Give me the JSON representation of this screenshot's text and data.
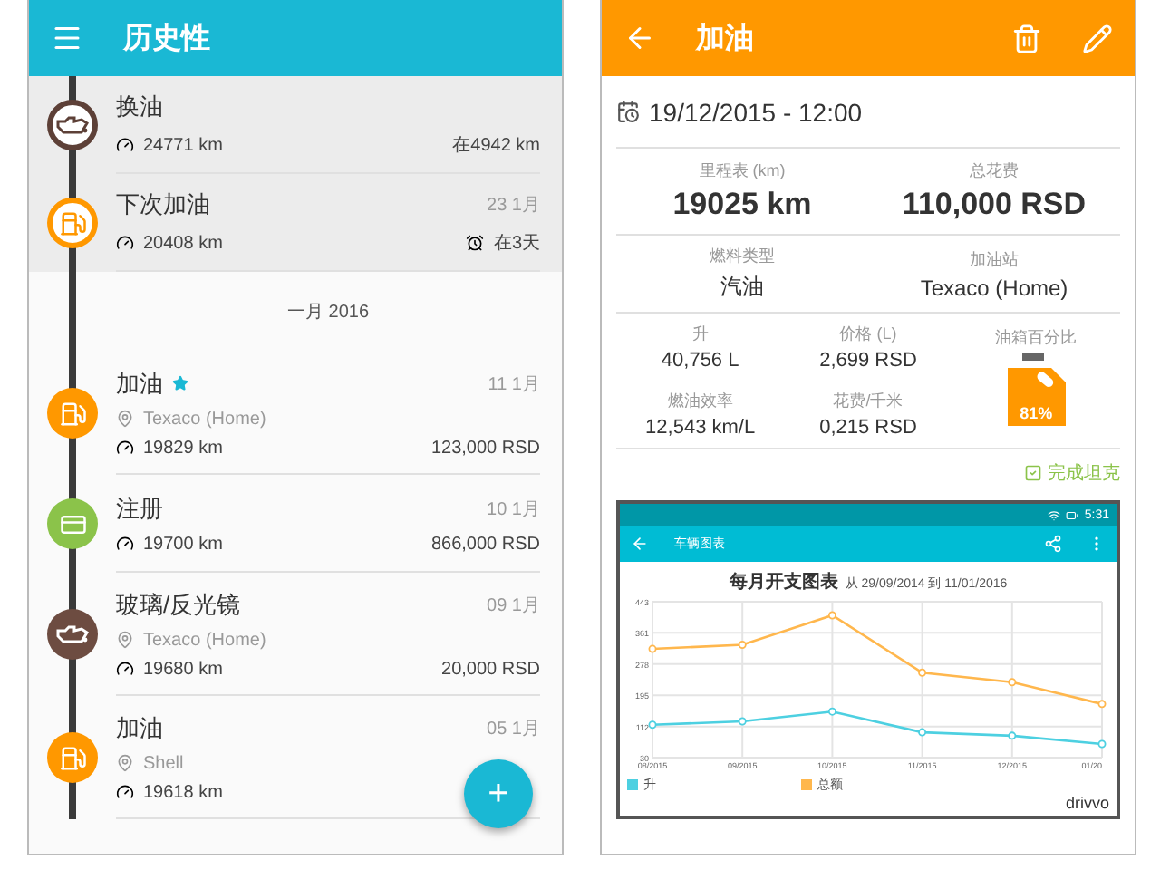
{
  "history": {
    "title": "历史性",
    "items": [
      {
        "kind": "oil",
        "color": "#5d4037",
        "outlined": true,
        "upcoming": true,
        "title": "换油",
        "starred": false,
        "odometer": "24771 km",
        "due": "在4942 km"
      },
      {
        "kind": "fuel",
        "color": "#ff9800",
        "outlined": true,
        "upcoming": true,
        "title": "下次加油",
        "starred": false,
        "date": "23 1月",
        "odometer": "20408 km",
        "due": "在3天",
        "alarm": true
      },
      {
        "kind": "header",
        "title": "一月 2016"
      },
      {
        "kind": "fuel",
        "color": "#ff9800",
        "outlined": false,
        "upcoming": false,
        "title": "加油",
        "starred": true,
        "date": "11 1月",
        "place": "Texaco (Home)",
        "odometer": "19829 km",
        "amount": "123,000 RSD"
      },
      {
        "kind": "registration",
        "color": "#8bc34a",
        "outlined": false,
        "upcoming": false,
        "title": "注册",
        "starred": false,
        "date": "10 1月",
        "odometer": "19700 km",
        "amount": "866,000 RSD"
      },
      {
        "kind": "oil",
        "color": "#6d4c41",
        "outlined": false,
        "upcoming": false,
        "title": "玻璃/反光镜",
        "starred": false,
        "date": "09 1月",
        "place": "Texaco (Home)",
        "odometer": "19680 km",
        "amount": "20,000 RSD"
      },
      {
        "kind": "fuel",
        "color": "#ff9800",
        "outlined": false,
        "upcoming": false,
        "title": "加油",
        "starred": false,
        "date": "05 1月",
        "place": "Shell",
        "odometer": "19618 km"
      }
    ],
    "fab": "+"
  },
  "detail": {
    "title": "加油",
    "datetime": "19/12/2015 - 12:00",
    "big_stats": [
      {
        "label": "里程表 (km)",
        "value": "19025 km"
      },
      {
        "label": "总花费",
        "value": "110,000 RSD"
      }
    ],
    "mid_stats": [
      {
        "label": "燃料类型",
        "value": "汽油"
      },
      {
        "label": "加油站",
        "value": "Texaco (Home)"
      }
    ],
    "small_stats": [
      {
        "label": "升",
        "value": "40,756 L"
      },
      {
        "label": "价格 (L)",
        "value": "2,699 RSD"
      },
      {
        "label": "燃油效率",
        "value": "12,543 km/L"
      },
      {
        "label": "花费/千米",
        "value": "0,215 RSD"
      }
    ],
    "tank": {
      "label": "油箱百分比",
      "value": "81%"
    },
    "full_tank": {
      "label": "完成坦克",
      "checked": true
    },
    "screenshot": {
      "time": "5:31",
      "title": "车辆图表",
      "chart_title": "每月开支图表",
      "range": "从 29/09/2014 到 11/01/2016",
      "logo": "drivvo",
      "chart_data": {
        "type": "line",
        "categories": [
          "08/2015",
          "09/2015",
          "10/2015",
          "11/2015",
          "12/2015",
          "01/20"
        ],
        "series": [
          {
            "name": "升",
            "color": "#4dd0e1",
            "marker": "circle",
            "values": [
              117,
              126,
              152,
              97,
              88,
              66
            ]
          },
          {
            "name": "总额",
            "color": "#ffb74d",
            "marker": "circle",
            "values": [
              318,
              329,
              407,
              255,
              230,
              172
            ]
          }
        ],
        "ylim": [
          30,
          443
        ],
        "grid": true,
        "yticks": [
          30,
          112,
          195,
          278,
          361,
          443
        ]
      }
    }
  }
}
